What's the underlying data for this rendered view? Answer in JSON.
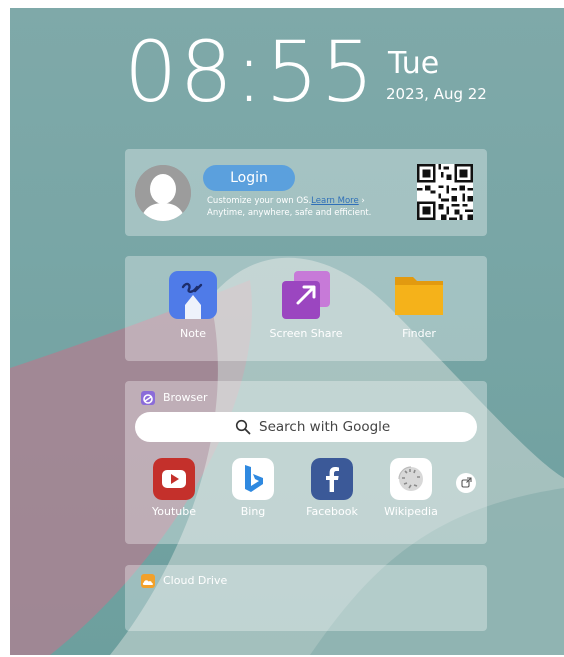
{
  "clock": {
    "time": "08:55",
    "day": "Tue",
    "date": "2023, Aug 22"
  },
  "account": {
    "login_label": "Login",
    "line1": "Customize your own OS.",
    "learn_more": "Learn More",
    "line2": "Anytime, anywhere, safe and efficient."
  },
  "apps": [
    {
      "label": "Note",
      "icon": "note-icon"
    },
    {
      "label": "Screen Share",
      "icon": "screen-share-icon"
    },
    {
      "label": "Finder",
      "icon": "folder-icon"
    }
  ],
  "browser": {
    "title": "Browser",
    "search_placeholder": "Search with Google",
    "sites": [
      {
        "label": "Youtube",
        "icon": "youtube-icon",
        "color": "#c4302b"
      },
      {
        "label": "Bing",
        "icon": "bing-icon",
        "color": "#2f89e0"
      },
      {
        "label": "Facebook",
        "icon": "facebook-icon",
        "color": "#3b5998"
      },
      {
        "label": "Wikipedia",
        "icon": "wikipedia-icon",
        "color": "#ffffff"
      }
    ]
  },
  "cloud": {
    "title": "Cloud Drive"
  },
  "colors": {
    "accent": "#5ba0dd",
    "folder": "#f5b21a",
    "browser_badge": "#8b6cd9",
    "cloud_badge": "#f2a12b"
  }
}
